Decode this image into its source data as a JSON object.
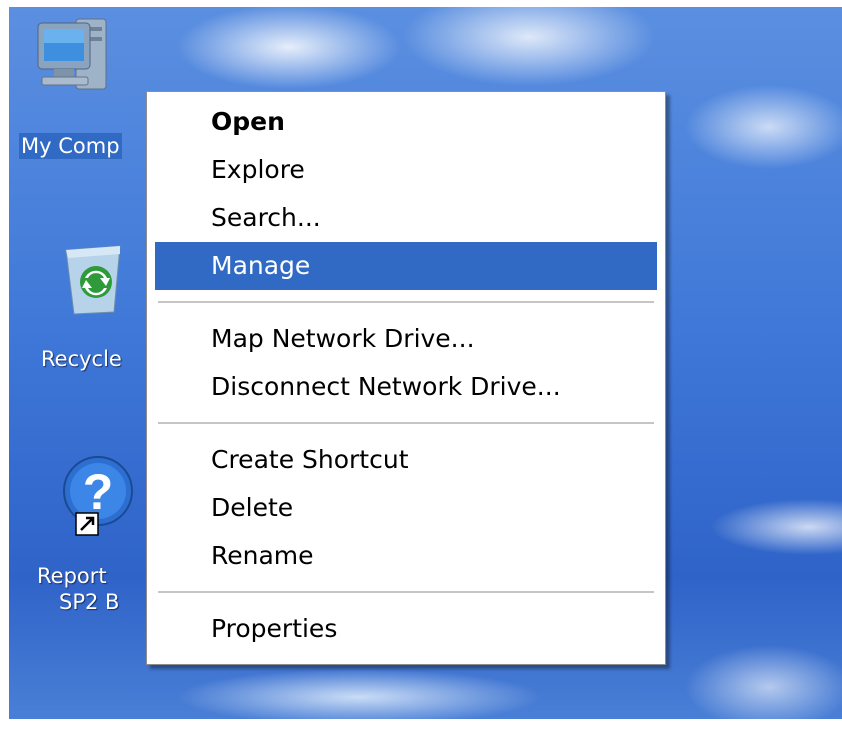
{
  "desktop": {
    "icons": [
      {
        "label_line1": "My Comp",
        "icon": "my-computer-icon",
        "selected": true
      },
      {
        "label_line1": "Recycle",
        "icon": "recycle-bin-icon",
        "selected": false
      },
      {
        "label_line1": "Report",
        "label_line2": "SP2 B",
        "icon": "help-icon",
        "selected": false
      }
    ]
  },
  "context_menu": {
    "items": [
      {
        "label": "Open",
        "style": "default"
      },
      {
        "label": "Explore"
      },
      {
        "label": "Search..."
      },
      {
        "label": "Manage",
        "state": "highlighted"
      },
      {
        "label": "Map Network Drive..."
      },
      {
        "label": "Disconnect Network Drive..."
      },
      {
        "label": "Create Shortcut"
      },
      {
        "label": "Delete"
      },
      {
        "label": "Rename"
      },
      {
        "label": "Properties"
      }
    ]
  },
  "colors": {
    "selection": "#316ac5",
    "desktop_blue": "#3f78d8",
    "menu_background": "#ffffff"
  }
}
